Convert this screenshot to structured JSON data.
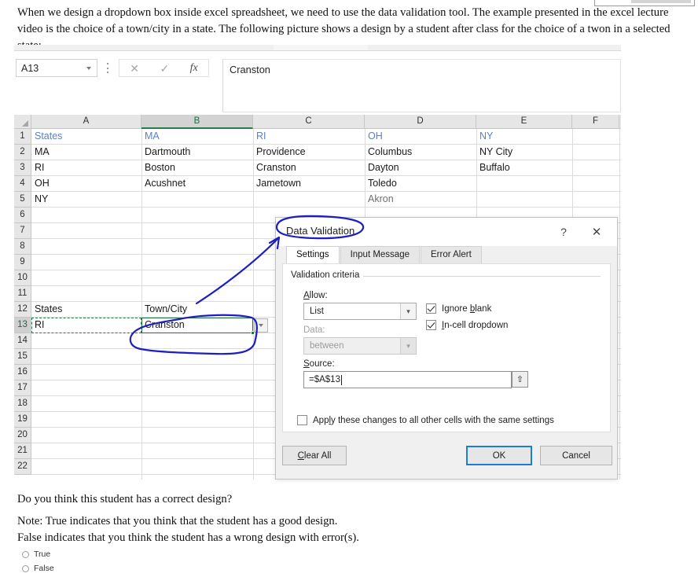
{
  "intro": {
    "paragraph": "When we design a dropdown box inside excel spreadsheet, we need to use the data validation tool. The example presented in the excel lecture video is the choice of a town/city in a state. The following picture shows a design by a student after class for the choice of a twon in a selected state:"
  },
  "question": {
    "prompt": "Do you think this student has a correct design?",
    "note_true": "Note: True indicates that you think that the student has a good design.",
    "note_false": "False indicates that you think the student has a wrong design with error(s).",
    "options": [
      {
        "label": "True",
        "selected": false
      },
      {
        "label": "False",
        "selected": false
      }
    ]
  },
  "excel": {
    "formula_bar": {
      "name_box_value": "A13",
      "cancel_icon": "close-icon",
      "enter_icon": "check-icon",
      "function_icon": "fx-icon",
      "formula_value": "Cranston"
    },
    "columns": [
      {
        "label": "A",
        "selected": false
      },
      {
        "label": "B",
        "selected": true
      },
      {
        "label": "C",
        "selected": false
      },
      {
        "label": "D",
        "selected": false
      },
      {
        "label": "E",
        "selected": false
      },
      {
        "label": "F",
        "selected": false
      }
    ],
    "rows": [
      "1",
      "2",
      "3",
      "4",
      "5",
      "6",
      "7",
      "8",
      "9",
      "10",
      "11",
      "12",
      "13",
      "14",
      "15",
      "16",
      "17",
      "18",
      "19",
      "20",
      "21",
      "22"
    ],
    "selected_row": "13",
    "cells": [
      {
        "ref": "A1",
        "row": 1,
        "col": 0,
        "value": "States",
        "style": "hdrblue"
      },
      {
        "ref": "B1",
        "row": 1,
        "col": 1,
        "value": "MA",
        "style": "hdrblue"
      },
      {
        "ref": "C1",
        "row": 1,
        "col": 2,
        "value": "RI",
        "style": "hdrblue"
      },
      {
        "ref": "D1",
        "row": 1,
        "col": 3,
        "value": "OH",
        "style": "hdrblue"
      },
      {
        "ref": "E1",
        "row": 1,
        "col": 4,
        "value": "NY",
        "style": "hdrblue"
      },
      {
        "ref": "A2",
        "row": 2,
        "col": 0,
        "value": "MA",
        "style": ""
      },
      {
        "ref": "B2",
        "row": 2,
        "col": 1,
        "value": "Dartmouth",
        "style": ""
      },
      {
        "ref": "C2",
        "row": 2,
        "col": 2,
        "value": "Providence",
        "style": ""
      },
      {
        "ref": "D2",
        "row": 2,
        "col": 3,
        "value": "Columbus",
        "style": ""
      },
      {
        "ref": "E2",
        "row": 2,
        "col": 4,
        "value": "NY City",
        "style": ""
      },
      {
        "ref": "A3",
        "row": 3,
        "col": 0,
        "value": "RI",
        "style": ""
      },
      {
        "ref": "B3",
        "row": 3,
        "col": 1,
        "value": "Boston",
        "style": ""
      },
      {
        "ref": "C3",
        "row": 3,
        "col": 2,
        "value": "Cranston",
        "style": ""
      },
      {
        "ref": "D3",
        "row": 3,
        "col": 3,
        "value": "Dayton",
        "style": ""
      },
      {
        "ref": "E3",
        "row": 3,
        "col": 4,
        "value": "Buffalo",
        "style": ""
      },
      {
        "ref": "A4",
        "row": 4,
        "col": 0,
        "value": "OH",
        "style": ""
      },
      {
        "ref": "B4",
        "row": 4,
        "col": 1,
        "value": "Acushnet",
        "style": ""
      },
      {
        "ref": "C4",
        "row": 4,
        "col": 2,
        "value": "Jametown",
        "style": ""
      },
      {
        "ref": "D4",
        "row": 4,
        "col": 3,
        "value": "Toledo",
        "style": ""
      },
      {
        "ref": "A5",
        "row": 5,
        "col": 0,
        "value": "NY",
        "style": ""
      },
      {
        "ref": "D5",
        "row": 5,
        "col": 3,
        "value": "Akron",
        "style": "gray"
      },
      {
        "ref": "A12",
        "row": 12,
        "col": 0,
        "value": "States",
        "style": ""
      },
      {
        "ref": "B12",
        "row": 12,
        "col": 1,
        "value": "Town/City",
        "style": ""
      },
      {
        "ref": "A13",
        "row": 13,
        "col": 0,
        "value": "RI",
        "style": ""
      },
      {
        "ref": "B13",
        "row": 13,
        "col": 1,
        "value": "Cranston",
        "style": ""
      }
    ]
  },
  "dialog": {
    "title": "Data Validation",
    "help_label": "?",
    "close_label": "✕",
    "tabs": [
      {
        "label": "Settings",
        "active": true
      },
      {
        "label": "Input Message",
        "active": false
      },
      {
        "label": "Error Alert",
        "active": false
      }
    ],
    "group_label": "Validation criteria",
    "allow_label": "Allow:",
    "allow_value": "List",
    "data_label": "Data:",
    "data_value": "between",
    "source_label": "Source:",
    "source_value": "=$A$13",
    "range_select_icon": "range-select-icon",
    "checkboxes": [
      {
        "label": "Ignore blank",
        "checked": true
      },
      {
        "label": "In-cell dropdown",
        "checked": true
      }
    ],
    "apply_all": {
      "label": "Apply these changes to all other cells with the same settings",
      "checked": false
    },
    "buttons": [
      {
        "label": "Clear All",
        "primary": false
      },
      {
        "label": "OK",
        "primary": true
      },
      {
        "label": "Cancel",
        "primary": false
      }
    ]
  },
  "annotation": {
    "color": "#1b1ec4",
    "shapes": [
      "ellipse-around-dialog-title",
      "arrow-to-dialog-title",
      "ellipse-around-cell-b13"
    ]
  }
}
